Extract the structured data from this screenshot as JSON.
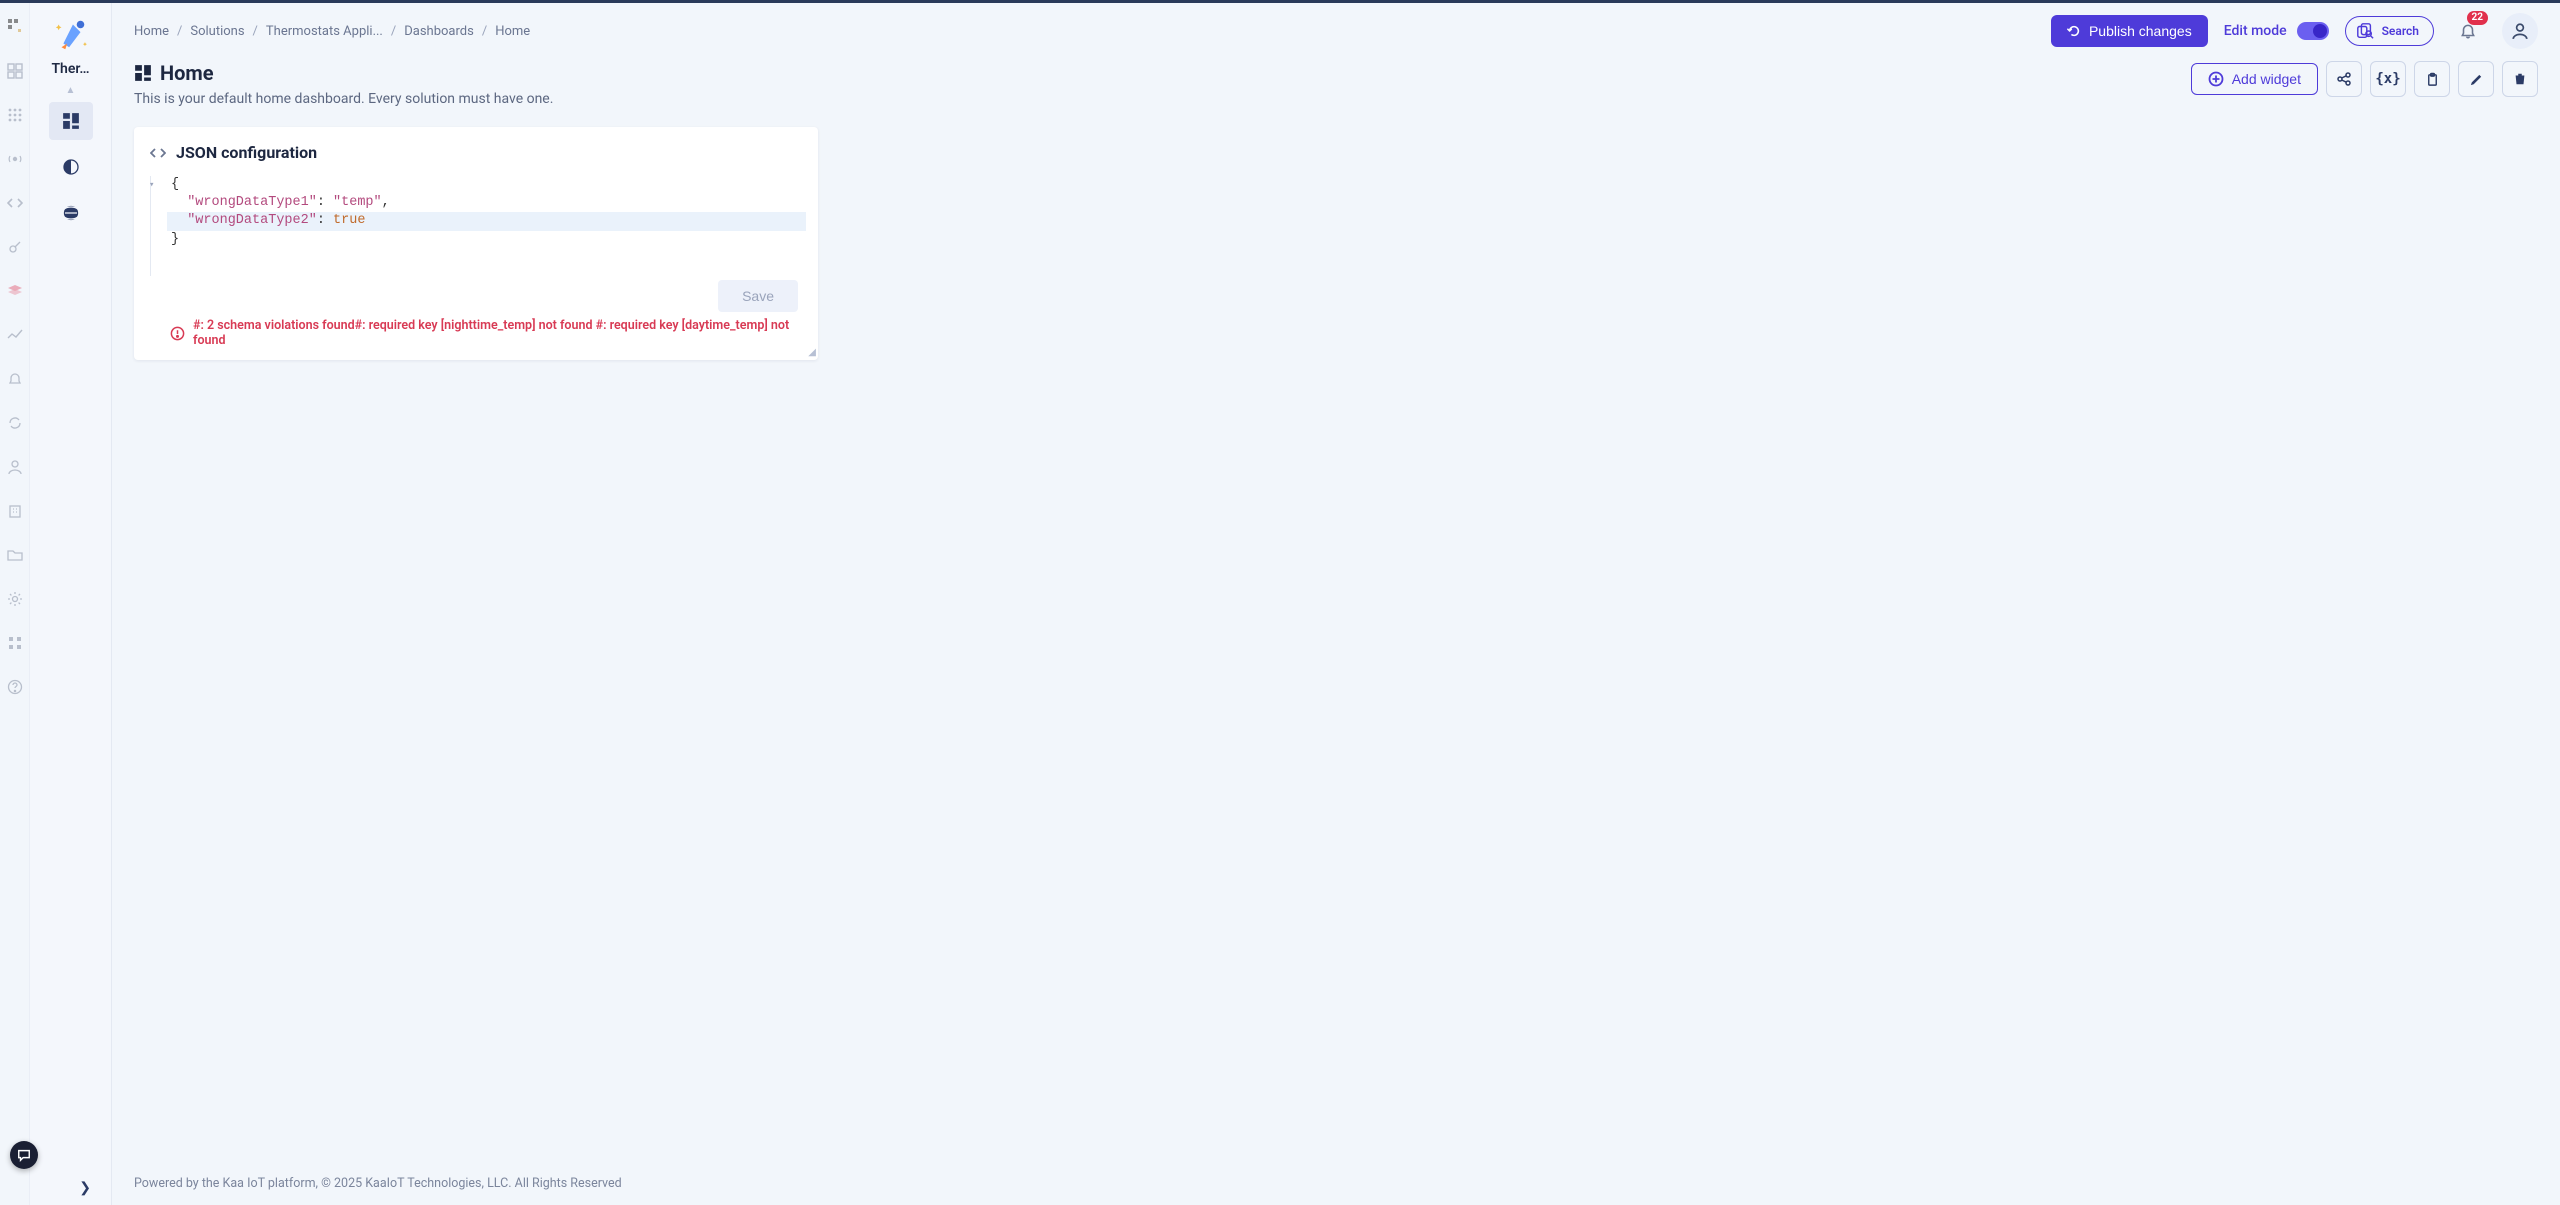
{
  "breadcrumb": {
    "items": [
      {
        "label": "Home"
      },
      {
        "label": "Solutions"
      },
      {
        "label": "Thermostats Appli..."
      },
      {
        "label": "Dashboards"
      }
    ],
    "current": "Home"
  },
  "header": {
    "publish_label": "Publish changes",
    "edit_mode_label": "Edit mode",
    "search_label": "Search",
    "notification_count": "22"
  },
  "sidebar": {
    "project_name": "Ther…"
  },
  "page": {
    "title": "Home",
    "subtitle": "This is your default home dashboard. Every solution must have one.",
    "add_widget_label": "Add widget"
  },
  "widget": {
    "title": "JSON configuration",
    "lines": {
      "l0": "{",
      "l1_key": "\"wrongDataType1\"",
      "l1_mid": ": ",
      "l1_val": "\"temp\"",
      "l1_end": ",",
      "l2_key": "\"wrongDataType2\"",
      "l2_mid": ": ",
      "l2_val": "true",
      "l3": "}"
    },
    "save_label": "Save",
    "error_text": "#: 2 schema violations found#: required key [nighttime_temp] not found #: required key [daytime_temp] not found"
  },
  "footer": {
    "text": "Powered by the Kaa IoT platform, © 2025 KaaIoT Technologies, LLC. All Rights Reserved"
  }
}
